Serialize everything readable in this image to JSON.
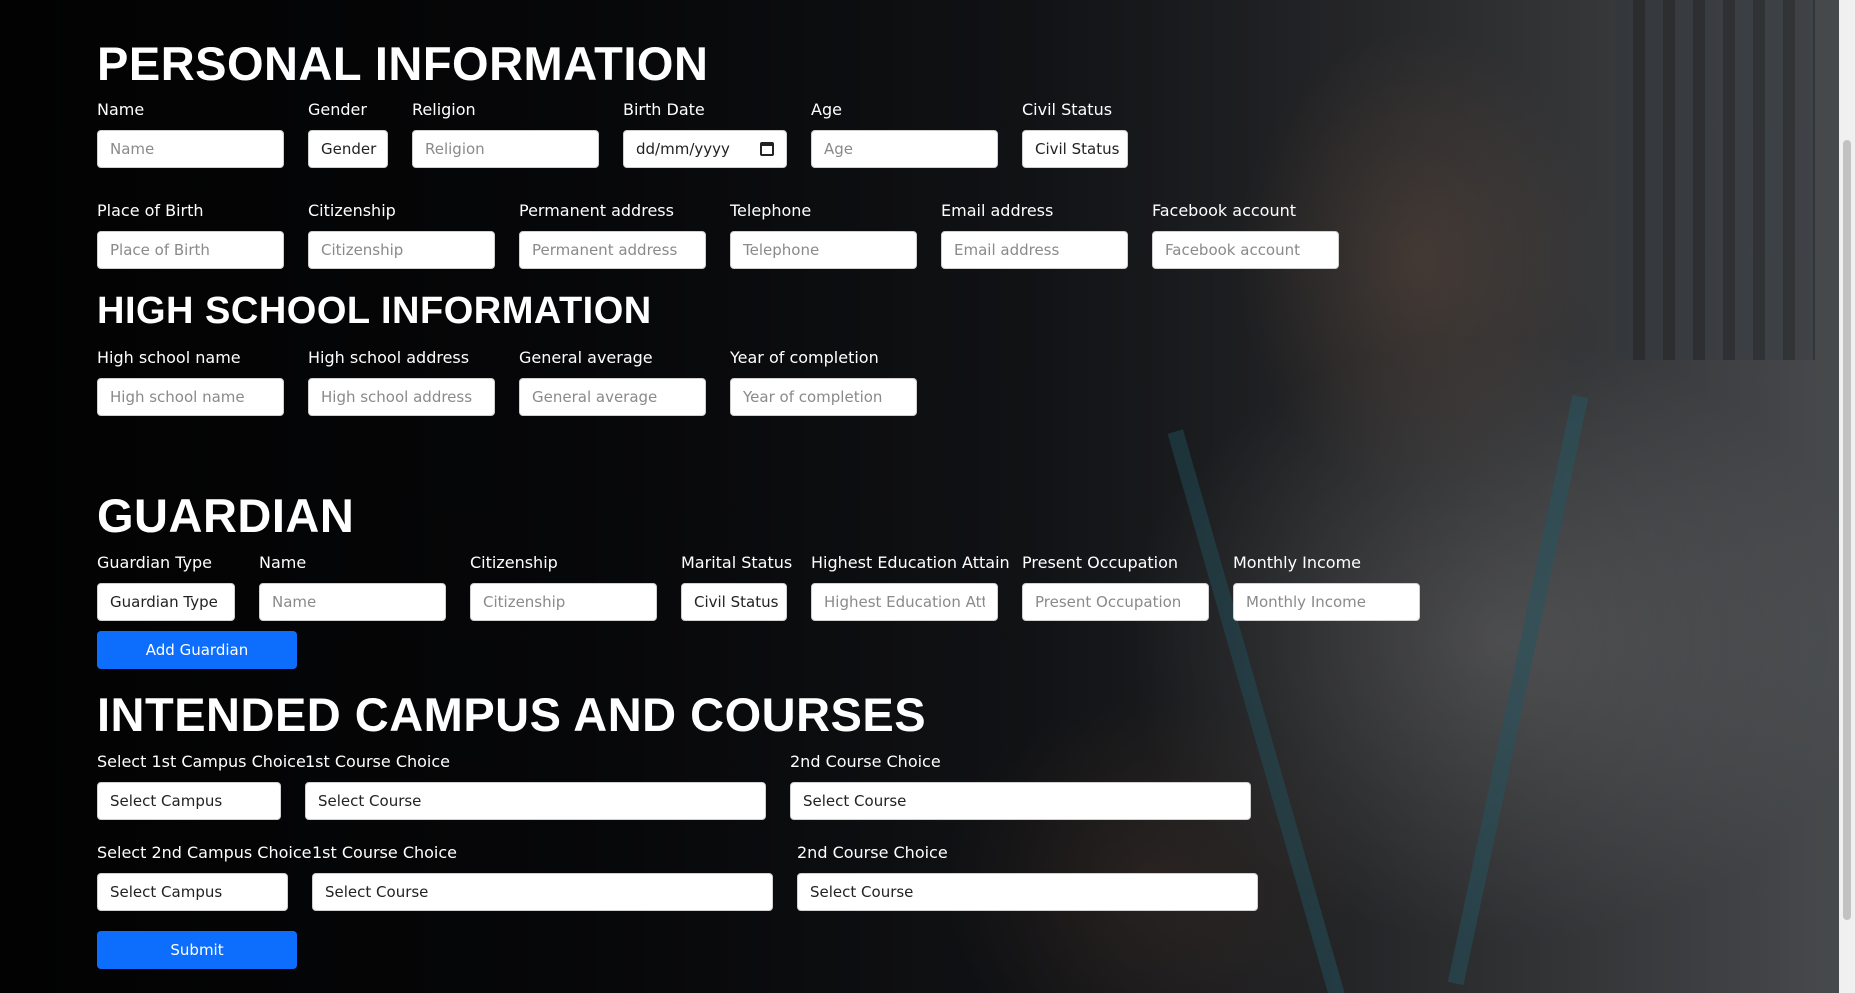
{
  "personal": {
    "heading": "PERSONAL INFORMATION",
    "name": {
      "label": "Name",
      "placeholder": "Name"
    },
    "gender": {
      "label": "Gender",
      "value": "Gender"
    },
    "religion": {
      "label": "Religion",
      "placeholder": "Religion"
    },
    "birth_date": {
      "label": "Birth Date",
      "value": "dd/mm/yyyy"
    },
    "age": {
      "label": "Age",
      "placeholder": "Age"
    },
    "civil_status": {
      "label": "Civil Status",
      "value": "Civil Status"
    },
    "place_of_birth": {
      "label": "Place of Birth",
      "placeholder": "Place of Birth"
    },
    "citizenship": {
      "label": "Citizenship",
      "placeholder": "Citizenship"
    },
    "permanent_address": {
      "label": "Permanent address",
      "placeholder": "Permanent address"
    },
    "telephone": {
      "label": "Telephone",
      "placeholder": "Telephone"
    },
    "email": {
      "label": "Email address",
      "placeholder": "Email address"
    },
    "facebook": {
      "label": "Facebook account",
      "placeholder": "Facebook account"
    }
  },
  "high_school": {
    "heading": "HIGH SCHOOL INFORMATION",
    "name": {
      "label": "High school name",
      "placeholder": "High school name"
    },
    "address": {
      "label": "High school address",
      "placeholder": "High school address"
    },
    "average": {
      "label": "General average",
      "placeholder": "General average"
    },
    "year": {
      "label": "Year of completion",
      "placeholder": "Year of completion"
    }
  },
  "guardian": {
    "heading": "GUARDIAN",
    "type": {
      "label": "Guardian Type",
      "value": "Guardian Type"
    },
    "name": {
      "label": "Name",
      "placeholder": "Name"
    },
    "citizenship": {
      "label": "Citizenship",
      "placeholder": "Citizenship"
    },
    "marital_status": {
      "label": "Marital Status",
      "value": "Civil Status"
    },
    "education": {
      "label": "Highest Education Attain",
      "placeholder": "Highest Education Attain"
    },
    "occupation": {
      "label": "Present Occupation",
      "placeholder": "Present Occupation"
    },
    "income": {
      "label": "Monthly Income",
      "placeholder": "Monthly Income"
    },
    "add_button": "Add Guardian"
  },
  "campus": {
    "heading": "INTENDED CAMPUS AND COURSES",
    "first": {
      "campus_label": "Select 1st Campus Choice",
      "campus_value": "Select Campus",
      "course1_label": "1st Course Choice",
      "course1_value": "Select Course",
      "course2_label": "2nd Course Choice",
      "course2_value": "Select Course"
    },
    "second": {
      "campus_label": "Select 2nd Campus Choice",
      "campus_value": "Select Campus",
      "course1_label": "1st Course Choice",
      "course1_value": "Select Course",
      "course2_label": "2nd Course Choice",
      "course2_value": "Select Course"
    },
    "submit_button": "Submit"
  }
}
